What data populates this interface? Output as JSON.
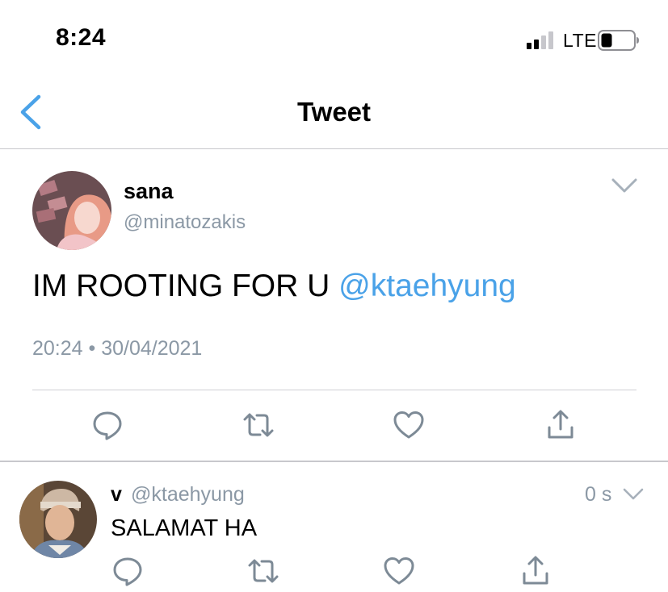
{
  "status_bar": {
    "time": "8:24",
    "network": "LTE",
    "signal_bars_filled": 2,
    "signal_bars_total": 4
  },
  "nav": {
    "title": "Tweet",
    "back_icon": "chevron-left-icon"
  },
  "tweet": {
    "author_name": "sana",
    "author_handle": "@minatozakis",
    "text": "IM ROOTING FOR U ",
    "mention": "@ktaehyung",
    "timestamp": "20:24 • 30/04/2021",
    "actions": [
      "reply-icon",
      "retweet-icon",
      "like-icon",
      "share-icon"
    ]
  },
  "reply": {
    "author_name": "v",
    "author_handle": "@ktaehyung",
    "time_ago": "0 s",
    "text": "SALAMAT HA",
    "actions": [
      "reply-icon",
      "retweet-icon",
      "like-icon",
      "share-icon"
    ]
  },
  "colors": {
    "accent": "#4aa2e8",
    "muted_text": "#8b98a5",
    "icon_gray": "#7d8a96",
    "divider": "#c8c8cc"
  }
}
